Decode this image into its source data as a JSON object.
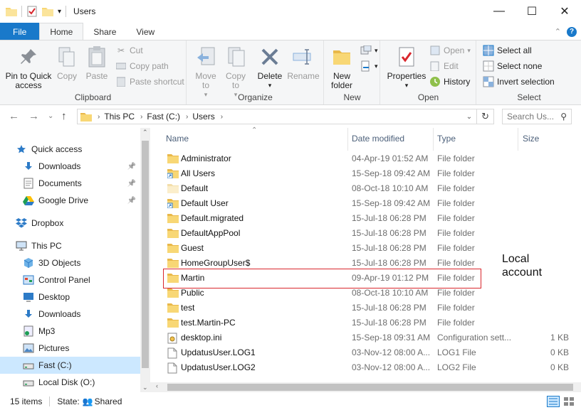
{
  "window": {
    "title": "Users",
    "minimize": "—",
    "maximize": "☐",
    "close": "✕"
  },
  "tabs": [
    "File",
    "Home",
    "Share",
    "View"
  ],
  "ribbon": {
    "clipboard": {
      "label": "Clipboard",
      "pin": "Pin to Quick access",
      "copy": "Copy",
      "paste": "Paste",
      "cut": "Cut",
      "copy_path": "Copy path",
      "paste_shortcut": "Paste shortcut"
    },
    "organize": {
      "label": "Organize",
      "move_to": "Move to",
      "copy_to": "Copy to",
      "delete": "Delete",
      "rename": "Rename"
    },
    "new": {
      "label": "New",
      "new_folder": "New folder"
    },
    "open": {
      "label": "Open",
      "properties": "Properties",
      "open": "Open",
      "edit": "Edit",
      "history": "History"
    },
    "select": {
      "label": "Select",
      "select_all": "Select all",
      "select_none": "Select none",
      "invert": "Invert selection"
    }
  },
  "address": {
    "crumbs": [
      "This PC",
      "Fast (C:)",
      "Users"
    ],
    "search_placeholder": "Search Us..."
  },
  "nav": [
    {
      "label": "Quick access",
      "icon": "star-icon",
      "pinned": false
    },
    {
      "label": "Downloads",
      "icon": "download-icon",
      "pinned": true
    },
    {
      "label": "Documents",
      "icon": "document-icon",
      "pinned": true
    },
    {
      "label": "Google Drive",
      "icon": "google-drive-icon",
      "pinned": true
    },
    {
      "label": "Dropbox",
      "icon": "dropbox-icon",
      "pinned": false
    },
    {
      "label": "This PC",
      "icon": "computer-icon",
      "pinned": false
    },
    {
      "label": "3D Objects",
      "icon": "cube-icon",
      "pinned": false
    },
    {
      "label": "Control Panel",
      "icon": "control-panel-icon",
      "pinned": false
    },
    {
      "label": "Desktop",
      "icon": "desktop-icon",
      "pinned": false
    },
    {
      "label": "Downloads",
      "icon": "download-icon",
      "pinned": false
    },
    {
      "label": "Mp3",
      "icon": "music-icon",
      "pinned": false
    },
    {
      "label": "Pictures",
      "icon": "pictures-icon",
      "pinned": false
    },
    {
      "label": "Fast (C:)",
      "icon": "drive-icon",
      "pinned": false
    },
    {
      "label": "Local Disk (O:)",
      "icon": "drive-icon",
      "pinned": false
    }
  ],
  "columns": {
    "name": "Name",
    "date": "Date modified",
    "type": "Type",
    "size": "Size"
  },
  "files": [
    {
      "name": "Administrator",
      "date": "04-Apr-19 01:52 AM",
      "type": "File folder",
      "size": "",
      "icon": "folder-icon"
    },
    {
      "name": "All Users",
      "date": "15-Sep-18 09:42 AM",
      "type": "File folder",
      "size": "",
      "icon": "folder-shortcut-icon"
    },
    {
      "name": "Default",
      "date": "08-Oct-18 10:10 AM",
      "type": "File folder",
      "size": "",
      "icon": "folder-hidden-icon"
    },
    {
      "name": "Default User",
      "date": "15-Sep-18 09:42 AM",
      "type": "File folder",
      "size": "",
      "icon": "folder-shortcut-icon"
    },
    {
      "name": "Default.migrated",
      "date": "15-Jul-18 06:28 PM",
      "type": "File folder",
      "size": "",
      "icon": "folder-icon"
    },
    {
      "name": "DefaultAppPool",
      "date": "15-Jul-18 06:28 PM",
      "type": "File folder",
      "size": "",
      "icon": "folder-icon"
    },
    {
      "name": "Guest",
      "date": "15-Jul-18 06:28 PM",
      "type": "File folder",
      "size": "",
      "icon": "folder-icon"
    },
    {
      "name": "HomeGroupUser$",
      "date": "15-Jul-18 06:28 PM",
      "type": "File folder",
      "size": "",
      "icon": "folder-icon"
    },
    {
      "name": "Martin",
      "date": "09-Apr-19 01:12 PM",
      "type": "File folder",
      "size": "",
      "icon": "folder-icon"
    },
    {
      "name": "Public",
      "date": "08-Oct-18 10:10 AM",
      "type": "File folder",
      "size": "",
      "icon": "folder-icon"
    },
    {
      "name": "test",
      "date": "15-Jul-18 06:28 PM",
      "type": "File folder",
      "size": "",
      "icon": "folder-icon"
    },
    {
      "name": "test.Martin-PC",
      "date": "15-Jul-18 06:28 PM",
      "type": "File folder",
      "size": "",
      "icon": "folder-icon"
    },
    {
      "name": "desktop.ini",
      "date": "15-Sep-18 09:31 AM",
      "type": "Configuration sett...",
      "size": "1 KB",
      "icon": "settings-file-icon"
    },
    {
      "name": "UpdatusUser.LOG1",
      "date": "03-Nov-12 08:00 A...",
      "type": "LOG1 File",
      "size": "0 KB",
      "icon": "file-icon"
    },
    {
      "name": "UpdatusUser.LOG2",
      "date": "03-Nov-12 08:00 A...",
      "type": "LOG2 File",
      "size": "0 KB",
      "icon": "file-icon"
    }
  ],
  "annotation": {
    "line1": "Local",
    "line2": "account",
    "color": "#d9262c"
  },
  "status": {
    "count": "15 items",
    "state_label": "State:",
    "state_value": "Shared"
  },
  "colors": {
    "accent": "#1979ca",
    "folder": "#f8d775",
    "selected": "#cce8ff"
  }
}
